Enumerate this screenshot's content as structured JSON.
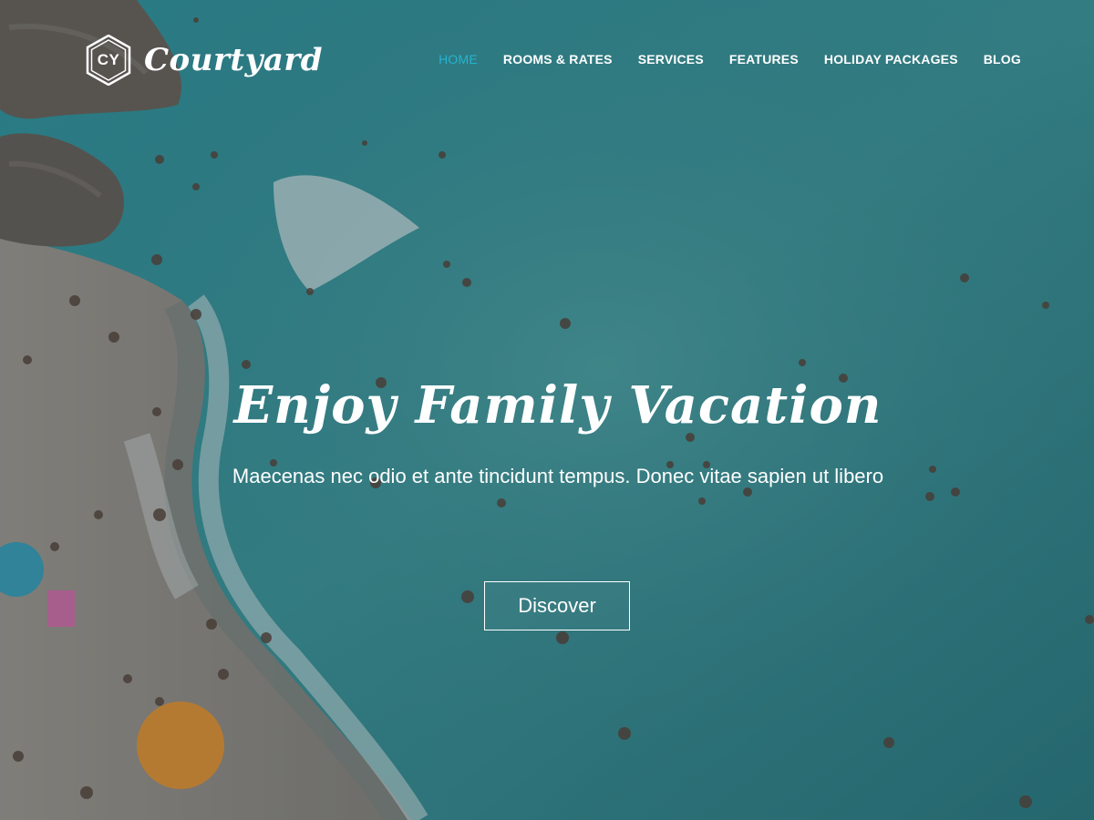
{
  "brand": {
    "initials": "CY",
    "name": "Courtyard"
  },
  "nav": {
    "items": [
      {
        "label": "HOME",
        "active": true
      },
      {
        "label": "ROOMS & RATES",
        "active": false
      },
      {
        "label": "SERVICES",
        "active": false
      },
      {
        "label": "FEATURES",
        "active": false
      },
      {
        "label": "HOLIDAY PACKAGES",
        "active": false
      },
      {
        "label": "BLOG",
        "active": false
      }
    ]
  },
  "hero": {
    "title": "Enjoy Family Vacation",
    "subtitle": "Maecenas nec odio et ante tincidunt tempus. Donec vitae sapien ut libero",
    "cta_label": "Discover"
  },
  "colors": {
    "accent": "#25b4d0",
    "sea": "#3a8e93",
    "text": "#ffffff"
  }
}
